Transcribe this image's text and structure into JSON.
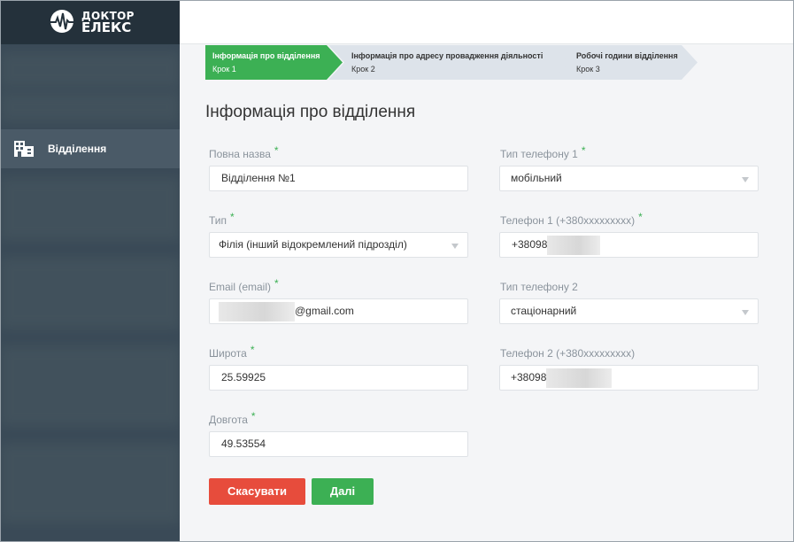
{
  "brand": {
    "line1": "ДОКТОР",
    "line2": "ЕЛЕКС"
  },
  "sidebar": {
    "items": [
      {
        "label": "Відділення",
        "icon": "building-icon",
        "active": true
      }
    ]
  },
  "steps": [
    {
      "title": "Інформація про відділення",
      "sub": "Крок 1",
      "active": true
    },
    {
      "title": "Інформація про адресу провадження діяльності",
      "sub": "Крок 2",
      "active": false
    },
    {
      "title": "Робочі години відділення",
      "sub": "Крок 3",
      "active": false
    }
  ],
  "page_title": "Інформація про відділення",
  "form": {
    "full_name": {
      "label": "Повна назва",
      "value": "Відділення №1"
    },
    "type": {
      "label": "Тип",
      "value": "Філія (інший відокремлений підрозділ)"
    },
    "email": {
      "label": "Email (email)",
      "value": "@gmail.com"
    },
    "latitude": {
      "label": "Широта",
      "value": "25.59925"
    },
    "longitude": {
      "label": "Довгота",
      "value": "49.53554"
    },
    "phone1_type": {
      "label": "Тип телефону 1",
      "value": "мобільний"
    },
    "phone1": {
      "label": "Телефон 1 (+380xxxxxxxxx)",
      "value": "+38098"
    },
    "phone2_type": {
      "label": "Тип телефону 2",
      "value": "стаціонарний"
    },
    "phone2": {
      "label": "Телефон 2 (+380xxxxxxxxx)",
      "value": "+38098"
    },
    "required_mark": "*"
  },
  "buttons": {
    "cancel": "Скасувати",
    "next": "Далі"
  },
  "colors": {
    "sidebar": "#3a4a57",
    "sidebar_top": "#24313b",
    "accent_green": "#3cb054",
    "danger_red": "#e74c3c",
    "step_inactive": "#dde3ea",
    "background": "#f4f5f7"
  }
}
